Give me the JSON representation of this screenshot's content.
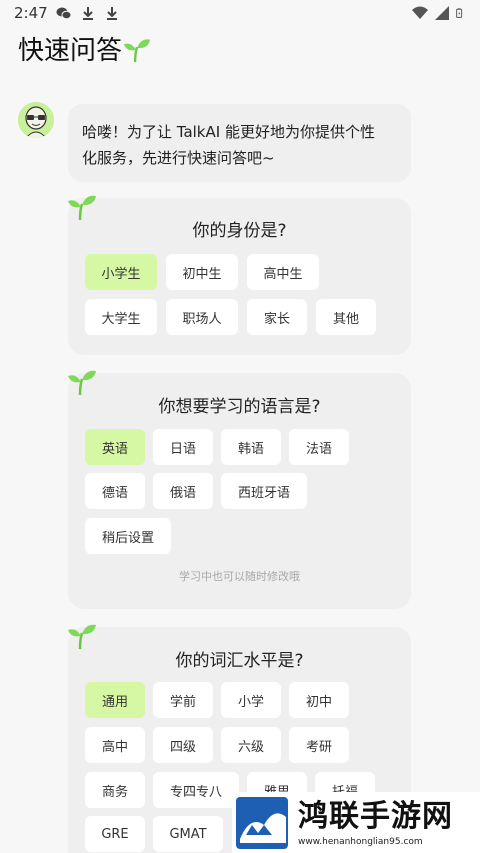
{
  "status_bar": {
    "time": "2:47",
    "icons": [
      "wechat-icon",
      "download-icon",
      "download-icon"
    ],
    "right_icons": [
      "wifi-icon",
      "signal-icon",
      "battery-icon"
    ]
  },
  "header": {
    "title": "快速问答",
    "icon": "sprout-icon"
  },
  "intro": {
    "avatar": "alien-avatar",
    "line1": "哈喽！为了让 TalkAI 能更好地为你提供个性",
    "line2": "化服务，先进行快速问答吧~"
  },
  "questions": [
    {
      "title": "你的身份是?",
      "options": [
        "小学生",
        "初中生",
        "高中生",
        "大学生",
        "职场人",
        "家长",
        "其他"
      ],
      "selected": "小学生"
    },
    {
      "title": "你想要学习的语言是?",
      "options": [
        "英语",
        "日语",
        "韩语",
        "法语",
        "德语",
        "俄语",
        "西班牙语",
        "稍后设置"
      ],
      "selected": "英语",
      "hint": "学习中也可以随时修改哦"
    },
    {
      "title": "你的词汇水平是?",
      "options": [
        "通用",
        "学前",
        "小学",
        "初中",
        "高中",
        "四级",
        "六级",
        "考研",
        "商务",
        "专四专八",
        "雅思",
        "托福",
        "GRE",
        "GMAT"
      ],
      "selected": "通用"
    }
  ],
  "watermark": {
    "name": "鸿联手游网",
    "url": "www.henanhonglian95.com"
  },
  "colors": {
    "selected": "#d6f7a3",
    "card": "#efefef",
    "background": "#f7f7f7",
    "sprout": "#7ed957"
  }
}
